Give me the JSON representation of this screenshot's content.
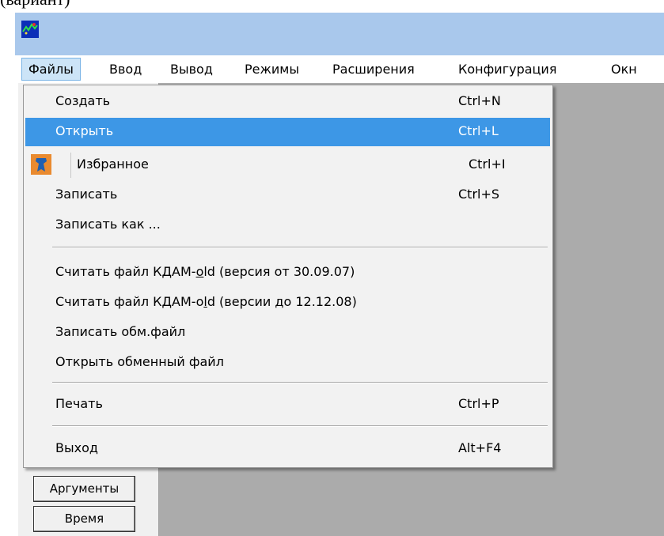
{
  "top_text": "(вариант)",
  "menubar": {
    "items": [
      {
        "label": "Файлы",
        "active": true
      },
      {
        "label": "Ввод"
      },
      {
        "label": "Вывод"
      },
      {
        "label": "Режимы"
      },
      {
        "label": "Расширения"
      },
      {
        "label": "Конфигурация"
      },
      {
        "label": "Окн"
      }
    ]
  },
  "file_menu": {
    "items": [
      {
        "label": "Создать",
        "shortcut": "Ctrl+N"
      },
      {
        "label": "Открыть",
        "shortcut": "Ctrl+L",
        "highlighted": true
      },
      {
        "label": "Избранное",
        "shortcut": "Ctrl+I",
        "icon": "favorites-icon"
      },
      {
        "label": "Записать",
        "shortcut": "Ctrl+S"
      },
      {
        "label": "Записать как ..."
      },
      {
        "label_a": "Считать файл КДАМ-",
        "label_u1": "o",
        "label_b": "ld (версия от 30.09.07)"
      },
      {
        "label_a": "Считать файл КДАМ-o",
        "label_u1": "l",
        "label_b": "d (версии до 12.12.08)"
      },
      {
        "label": "Записать обм.файл"
      },
      {
        "label": "Открыть обменный файл"
      },
      {
        "label": "Печать",
        "shortcut": "Ctrl+P"
      },
      {
        "label": "Выход",
        "shortcut": "Alt+F4"
      }
    ]
  },
  "left_panel": {
    "buttons": [
      {
        "label": "Аргументы"
      },
      {
        "label": "Время"
      }
    ]
  },
  "colors": {
    "titlebar": "#a9c8ec",
    "menu_highlight": "#3d97e6",
    "menubar_active": "#cce4f7",
    "client_bg": "#ababab"
  }
}
